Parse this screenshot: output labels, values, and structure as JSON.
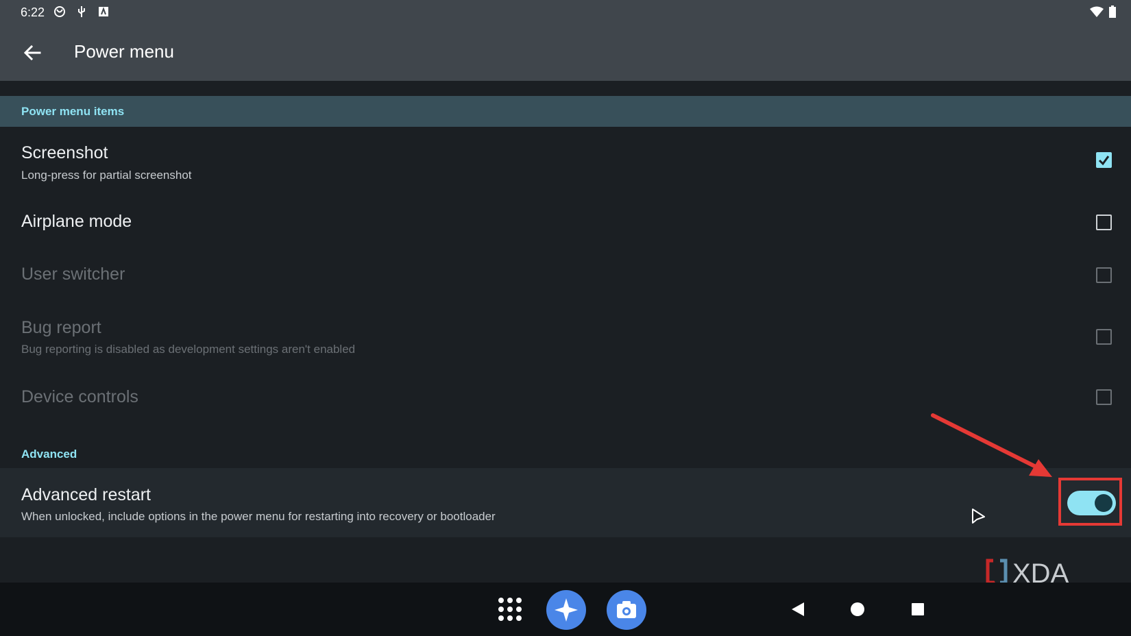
{
  "status_bar": {
    "time": "6:22"
  },
  "app_bar": {
    "title": "Power menu"
  },
  "sections": {
    "power_menu_items": {
      "title": "Power menu items"
    },
    "advanced": {
      "title": "Advanced"
    }
  },
  "items": [
    {
      "title": "Screenshot",
      "subtitle": "Long-press for partial screenshot",
      "checked": true,
      "enabled": true
    },
    {
      "title": "Airplane mode",
      "subtitle": "",
      "checked": false,
      "enabled": true
    },
    {
      "title": "User switcher",
      "subtitle": "",
      "checked": false,
      "enabled": false
    },
    {
      "title": "Bug report",
      "subtitle": "Bug reporting is disabled as development settings aren't enabled",
      "checked": false,
      "enabled": false
    },
    {
      "title": "Device controls",
      "subtitle": "",
      "checked": false,
      "enabled": false
    }
  ],
  "advanced_restart": {
    "title": "Advanced restart",
    "subtitle": "When unlocked, include options in the power menu for restarting into recovery or bootloader",
    "on": true
  },
  "watermark": {
    "text": "XDA"
  },
  "colors": {
    "accent": "#8fe3f3",
    "highlight": "#e53935",
    "app_bar": "#40464c",
    "background": "#1b1f23"
  },
  "icons": {
    "back": "arrow-left-icon",
    "app_drawer": "grid-dots-icon",
    "assistant": "sparkle-icon",
    "camera": "camera-icon",
    "nav_back": "triangle-back-icon",
    "nav_home": "circle-home-icon",
    "nav_recents": "square-recents-icon"
  }
}
